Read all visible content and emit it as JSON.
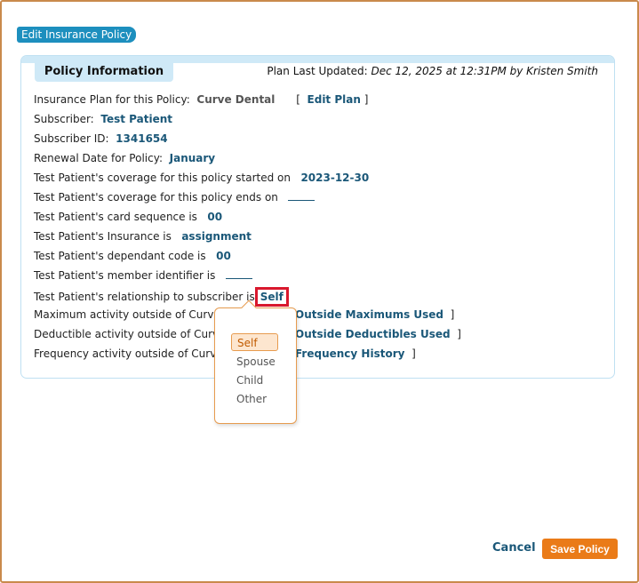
{
  "window": {
    "title": "Edit Insurance Policy"
  },
  "panel": {
    "tab_label": "Policy Information",
    "last_updated_label": "Plan Last Updated:",
    "last_updated_value": "Dec 12, 2025 at 12:31PM by Kristen Smith"
  },
  "fields": {
    "plan_label": "Insurance Plan for this Policy:",
    "plan_value": "Curve Dental",
    "edit_plan_link": "Edit Plan",
    "subscriber_label": "Subscriber:",
    "subscriber_value": "Test Patient",
    "subscriber_id_label": "Subscriber ID:",
    "subscriber_id_value": "1341654",
    "renewal_label": "Renewal Date for Policy:",
    "renewal_value": "January",
    "coverage_start_label": "Test Patient's coverage for this policy started on",
    "coverage_start_value": "2023-12-30",
    "coverage_end_label": "Test Patient's coverage for this policy ends on",
    "card_sequence_label": "Test Patient's card sequence is",
    "card_sequence_value": "00",
    "insurance_label": "Test Patient's Insurance is",
    "insurance_value": "assignment",
    "dependant_label": "Test Patient's dependant code is",
    "dependant_value": "00",
    "member_id_label": "Test Patient's member identifier is",
    "relationship_label": "Test Patient's relationship to subscriber is",
    "relationship_value": "Self",
    "max_activity_label": "Maximum activity outside of Curve H",
    "max_activity_link": "Outside Maximums Used",
    "deductible_label": "Deductible activity outside of Curve",
    "deductible_link": "Outside Deductibles Used",
    "frequency_label": "Frequency activity outside of Curve I",
    "frequency_link": "Frequency History"
  },
  "relationship_dropdown": {
    "options": [
      "Self",
      "Spouse",
      "Child",
      "Other"
    ],
    "selected": "Self"
  },
  "footer": {
    "cancel_label": "Cancel",
    "save_label": "Save Policy"
  },
  "colors": {
    "accent_blue": "#1d8fbe",
    "value_blue": "#1a5778",
    "panel_band": "#cfe9f7",
    "orange": "#ea7b18",
    "highlight_red": "#d9182d"
  }
}
